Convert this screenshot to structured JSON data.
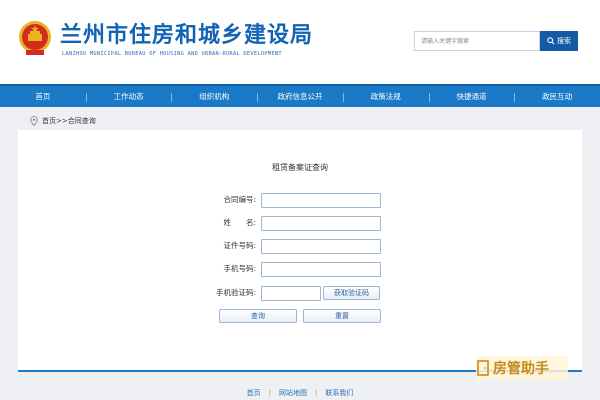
{
  "header": {
    "title": "兰州市住房和城乡建设局",
    "subtitle": "LANZHOU MUNICIPAL BUREAU OF HOUSING AND URBAN-RURAL DEVELOPMENT",
    "search": {
      "placeholder": "请输入关键字搜索",
      "button_label": "搜索"
    }
  },
  "nav": {
    "items": [
      "首页",
      "工作动态",
      "组织机构",
      "政府信息公开",
      "政策法规",
      "快捷通道",
      "政民互动"
    ]
  },
  "breadcrumb": {
    "text": "首页>>合同查询"
  },
  "form": {
    "title": "租赁备案证查询",
    "fields": {
      "contract_no": {
        "label": "合同编号:",
        "value": ""
      },
      "name": {
        "label": "姓　　名:",
        "value": ""
      },
      "id_no": {
        "label": "证件号码:",
        "value": ""
      },
      "phone": {
        "label": "手机号码:",
        "value": ""
      },
      "captcha": {
        "label": "手机验证码:",
        "value": ""
      }
    },
    "get_code_label": "获取验证码",
    "query_label": "查询",
    "reset_label": "重置"
  },
  "footer": {
    "links": [
      "首页",
      "网站地图",
      "联系我们"
    ]
  },
  "watermark": {
    "text": "房管助手"
  },
  "colors": {
    "brand_blue": "#1a7ac7",
    "title_blue": "#1263b5",
    "emblem_red": "#d42a1f",
    "emblem_gold": "#e8b521"
  }
}
